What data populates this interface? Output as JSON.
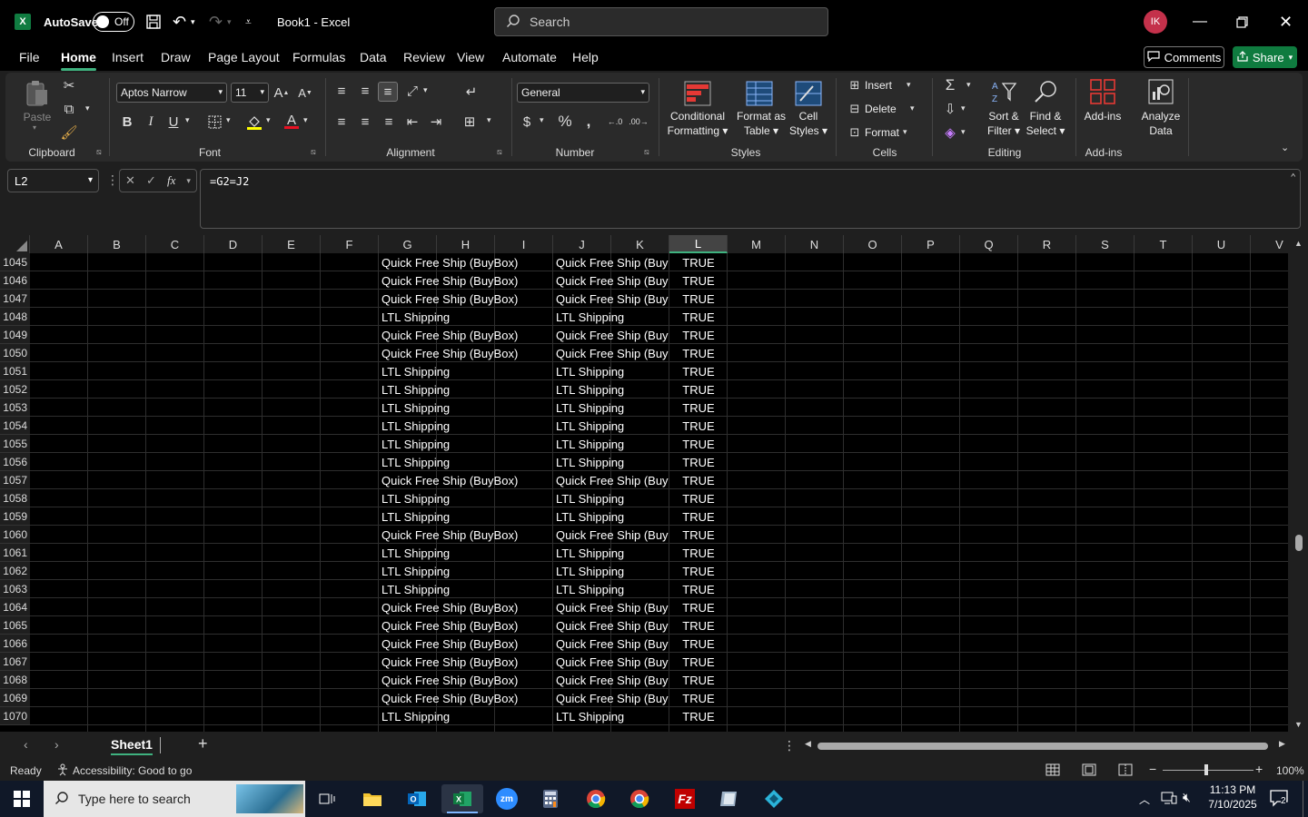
{
  "titlebar": {
    "autosave_label": "AutoSave",
    "autosave_state": "Off",
    "doc_title": "Book1  -  Excel",
    "search_placeholder": "Search",
    "avatar_initials": "IK"
  },
  "menu": {
    "tabs": [
      "File",
      "Home",
      "Insert",
      "Draw",
      "Page Layout",
      "Formulas",
      "Data",
      "Review",
      "View",
      "Automate",
      "Help"
    ],
    "active": "Home",
    "comments_label": "Comments",
    "share_label": "Share"
  },
  "ribbon": {
    "clipboard": {
      "label": "Clipboard",
      "paste": "Paste"
    },
    "font": {
      "label": "Font",
      "family": "Aptos Narrow",
      "size": "11"
    },
    "alignment": {
      "label": "Alignment"
    },
    "number": {
      "label": "Number",
      "format": "General"
    },
    "styles": {
      "label": "Styles",
      "conditional": "Conditional",
      "formatting": "Formatting",
      "format_as": "Format as",
      "table": "Table",
      "cell": "Cell",
      "cell_styles": "Styles"
    },
    "cells": {
      "label": "Cells",
      "insert": "Insert",
      "delete": "Delete",
      "format": "Format"
    },
    "editing": {
      "label": "Editing",
      "sort": "Sort &",
      "filter": "Filter",
      "find": "Find &",
      "select": "Select"
    },
    "addins": {
      "label": "Add-ins",
      "addins": "Add-ins",
      "analyze": "Analyze",
      "data": "Data"
    }
  },
  "formula_bar": {
    "name_box": "L2",
    "formula": "=G2=J2"
  },
  "columns": [
    "A",
    "B",
    "C",
    "D",
    "E",
    "F",
    "G",
    "H",
    "I",
    "J",
    "K",
    "L",
    "M",
    "N",
    "O",
    "P",
    "Q",
    "R",
    "S",
    "T",
    "U",
    "V"
  ],
  "selected_column": "L",
  "rows": [
    {
      "n": "1045",
      "g": "Quick Free Ship (BuyBox)",
      "j": "Quick Free Ship (Buy",
      "l": "TRUE"
    },
    {
      "n": "1046",
      "g": "Quick Free Ship (BuyBox)",
      "j": "Quick Free Ship (Buy",
      "l": "TRUE"
    },
    {
      "n": "1047",
      "g": "Quick Free Ship (BuyBox)",
      "j": "Quick Free Ship (Buy",
      "l": "TRUE"
    },
    {
      "n": "1048",
      "g": "LTL Shipping",
      "j": "LTL Shipping",
      "l": "TRUE"
    },
    {
      "n": "1049",
      "g": "Quick Free Ship (BuyBox)",
      "j": "Quick Free Ship (Buy",
      "l": "TRUE"
    },
    {
      "n": "1050",
      "g": "Quick Free Ship (BuyBox)",
      "j": "Quick Free Ship (Buy",
      "l": "TRUE"
    },
    {
      "n": "1051",
      "g": "LTL Shipping",
      "j": "LTL Shipping",
      "l": "TRUE"
    },
    {
      "n": "1052",
      "g": "LTL Shipping",
      "j": "LTL Shipping",
      "l": "TRUE"
    },
    {
      "n": "1053",
      "g": "LTL Shipping",
      "j": "LTL Shipping",
      "l": "TRUE"
    },
    {
      "n": "1054",
      "g": "LTL Shipping",
      "j": "LTL Shipping",
      "l": "TRUE"
    },
    {
      "n": "1055",
      "g": "LTL Shipping",
      "j": "LTL Shipping",
      "l": "TRUE"
    },
    {
      "n": "1056",
      "g": "LTL Shipping",
      "j": "LTL Shipping",
      "l": "TRUE"
    },
    {
      "n": "1057",
      "g": "Quick Free Ship (BuyBox)",
      "j": "Quick Free Ship (Buy",
      "l": "TRUE"
    },
    {
      "n": "1058",
      "g": "LTL Shipping",
      "j": "LTL Shipping",
      "l": "TRUE"
    },
    {
      "n": "1059",
      "g": "LTL Shipping",
      "j": "LTL Shipping",
      "l": "TRUE"
    },
    {
      "n": "1060",
      "g": "Quick Free Ship (BuyBox)",
      "j": "Quick Free Ship (Buy",
      "l": "TRUE"
    },
    {
      "n": "1061",
      "g": "LTL Shipping",
      "j": "LTL Shipping",
      "l": "TRUE"
    },
    {
      "n": "1062",
      "g": "LTL Shipping",
      "j": "LTL Shipping",
      "l": "TRUE"
    },
    {
      "n": "1063",
      "g": "LTL Shipping",
      "j": "LTL Shipping",
      "l": "TRUE"
    },
    {
      "n": "1064",
      "g": "Quick Free Ship (BuyBox)",
      "j": "Quick Free Ship (Buy",
      "l": "TRUE"
    },
    {
      "n": "1065",
      "g": "Quick Free Ship (BuyBox)",
      "j": "Quick Free Ship (Buy",
      "l": "TRUE"
    },
    {
      "n": "1066",
      "g": "Quick Free Ship (BuyBox)",
      "j": "Quick Free Ship (Buy",
      "l": "TRUE"
    },
    {
      "n": "1067",
      "g": "Quick Free Ship (BuyBox)",
      "j": "Quick Free Ship (Buy",
      "l": "TRUE"
    },
    {
      "n": "1068",
      "g": "Quick Free Ship (BuyBox)",
      "j": "Quick Free Ship (Buy",
      "l": "TRUE"
    },
    {
      "n": "1069",
      "g": "Quick Free Ship (BuyBox)",
      "j": "Quick Free Ship (Buy",
      "l": "TRUE"
    },
    {
      "n": "1070",
      "g": "LTL Shipping",
      "j": "LTL Shipping",
      "l": "TRUE"
    }
  ],
  "sheets": {
    "active": "Sheet1"
  },
  "status": {
    "ready": "Ready",
    "accessibility": "Accessibility: Good to go",
    "zoom": "100%"
  },
  "taskbar": {
    "search_placeholder": "Type here to search",
    "time": "11:13 PM",
    "date": "7/10/2025",
    "notifications": "2"
  },
  "colors": {
    "accent": "#3fb27f",
    "excel_green": "#107c41",
    "share_green": "#0f7b3f",
    "avatar": "#c4314b"
  }
}
